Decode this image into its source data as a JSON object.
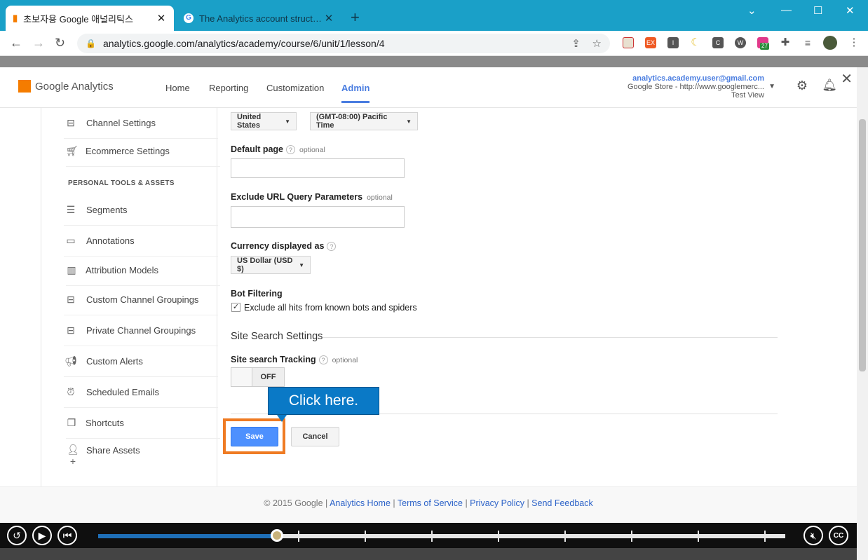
{
  "browser": {
    "tabs": [
      {
        "title": "초보자용 Google 애널리틱스",
        "close": "✕"
      },
      {
        "title": "The Analytics account structure",
        "close": "✕"
      }
    ],
    "new_tab": "+",
    "url": "analytics.google.com/analytics/academy/course/6/unit/1/lesson/4",
    "extension_badge": "27"
  },
  "ga": {
    "brand": "Google Analytics",
    "nav": [
      "Home",
      "Reporting",
      "Customization",
      "Admin"
    ],
    "active_nav": "Admin",
    "account": {
      "email": "analytics.academy.user@gmail.com",
      "property": "Google Store - http://www.googlemerc...",
      "view": "Test View"
    }
  },
  "sidebar": {
    "items_top": [
      "Channel Settings",
      "Ecommerce Settings"
    ],
    "section_heading": "PERSONAL TOOLS & ASSETS",
    "items": [
      "Segments",
      "Annotations",
      "Attribution Models",
      "Custom Channel Groupings",
      "Private Channel Groupings",
      "Custom Alerts",
      "Scheduled Emails",
      "Shortcuts",
      "Share Assets"
    ]
  },
  "form": {
    "country": "United States",
    "timezone": "(GMT-08:00) Pacific Time",
    "default_page_label": "Default page",
    "exclude_label": "Exclude URL Query Parameters",
    "optional": "optional",
    "currency_label": "Currency displayed as",
    "currency": "US Dollar (USD $)",
    "bot_label": "Bot Filtering",
    "bot_checkbox": "Exclude all hits from known bots and spiders",
    "site_search_section": "Site Search Settings",
    "site_search_label": "Site search Tracking",
    "toggle_state": "OFF",
    "save": "Save",
    "cancel": "Cancel",
    "help": "?"
  },
  "callout": "Click here.",
  "footer": {
    "copyright": "© 2015 Google",
    "links": [
      "Analytics Home",
      "Terms of Service",
      "Privacy Policy",
      "Send Feedback"
    ]
  },
  "player": {
    "progress": 0.26
  }
}
